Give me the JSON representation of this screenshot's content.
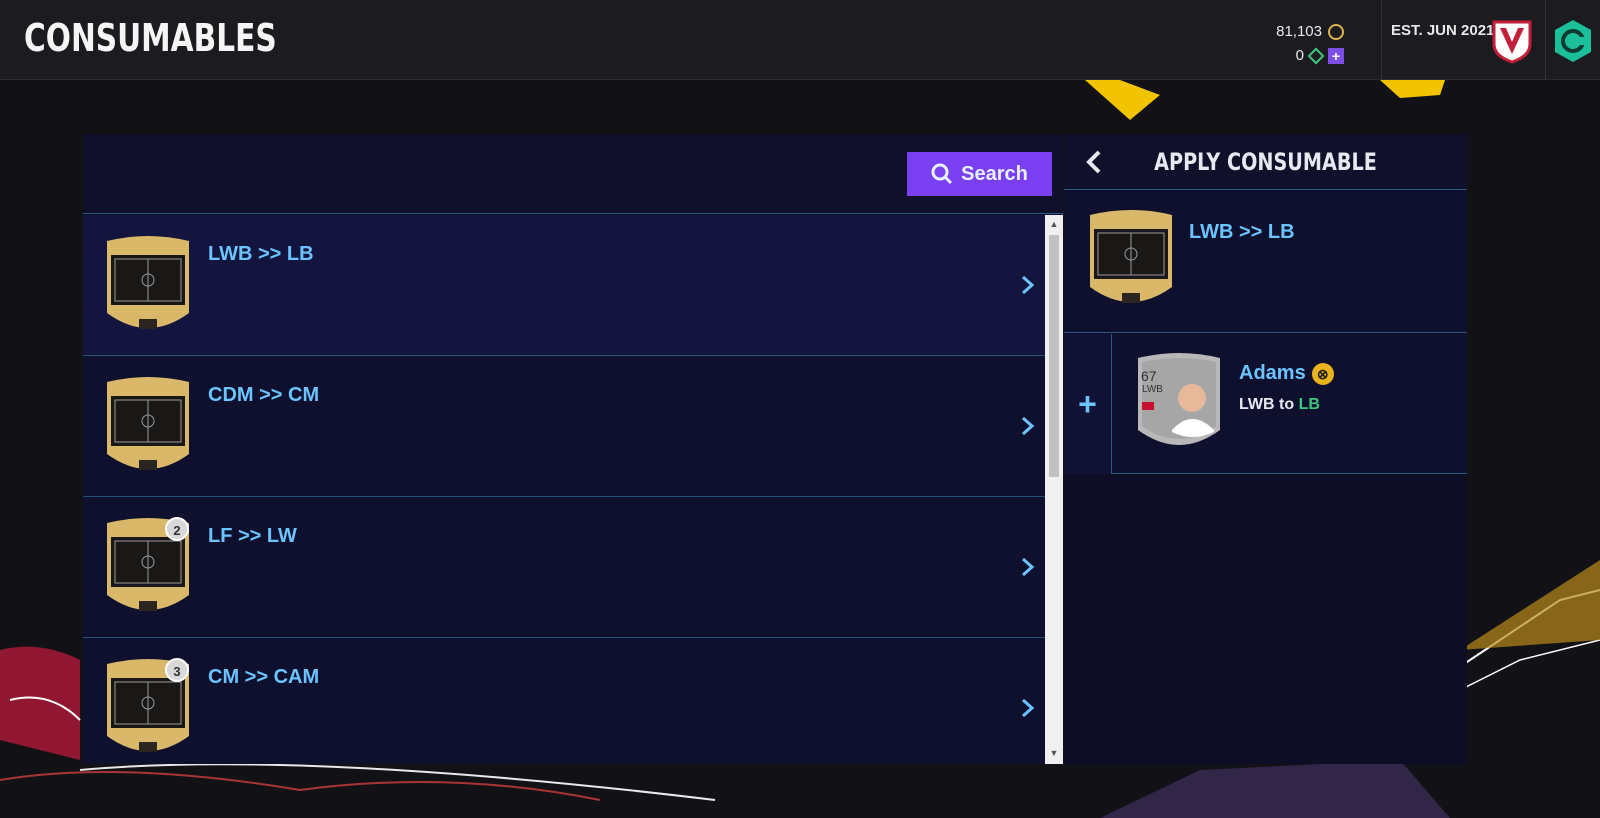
{
  "header": {
    "title": "CONSUMABLES",
    "coins": "81,103",
    "points": "0",
    "club_established": "EST. JUN 2021"
  },
  "toolbar": {
    "search_label": "Search"
  },
  "consumables": [
    {
      "label": "LWB >> LB",
      "count": "",
      "selected": true
    },
    {
      "label": "CDM >> CM",
      "count": "",
      "selected": false
    },
    {
      "label": "LF >> LW",
      "count": "2",
      "selected": false
    },
    {
      "label": "CM >> CAM",
      "count": "3",
      "selected": false
    }
  ],
  "apply_panel": {
    "title": "APPLY CONSUMABLE",
    "selected_item": "LWB >> LB",
    "player": {
      "name": "Adams",
      "rating": "67",
      "position": "LWB",
      "change_from": "LWB",
      "change_word": "to",
      "change_to": "LB"
    }
  },
  "colors": {
    "accent_blue": "#6cc4ff",
    "search_purple": "#7b3ff2",
    "gold_card": "#d9b86a",
    "positive_green": "#3ec97a"
  }
}
